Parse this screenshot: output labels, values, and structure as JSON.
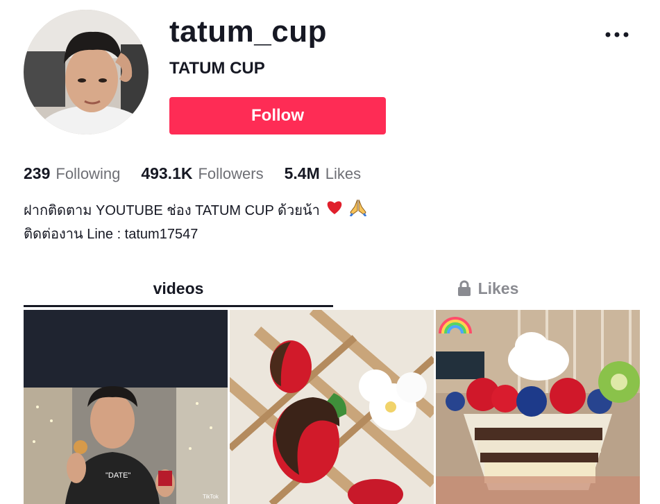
{
  "profile": {
    "username": "tatum_cup",
    "nickname": "TATUM CUP",
    "follow_label": "Follow"
  },
  "stats": [
    {
      "value": "239",
      "label": "Following"
    },
    {
      "value": "493.1K",
      "label": "Followers"
    },
    {
      "value": "5.4M",
      "label": "Likes"
    }
  ],
  "bio": {
    "line1": "ฝากติดตาม YOUTUBE ช่อง TATUM CUP ด้วยน้า",
    "line2": "ติดต่องาน Line : tatum17547"
  },
  "tabs": {
    "videos": "videos",
    "likes": "Likes"
  },
  "thumbnails": {
    "t1_shirt_text": "\"DATE\"",
    "t1_watermark": "TikTok"
  },
  "colors": {
    "accent": "#fe2c55",
    "text": "#161823",
    "muted": "#6e6f75"
  },
  "icons": {
    "more": "more-horizontal-icon",
    "lock": "lock-icon",
    "heart": "red-heart-emoji",
    "pray": "folded-hands-emoji"
  }
}
